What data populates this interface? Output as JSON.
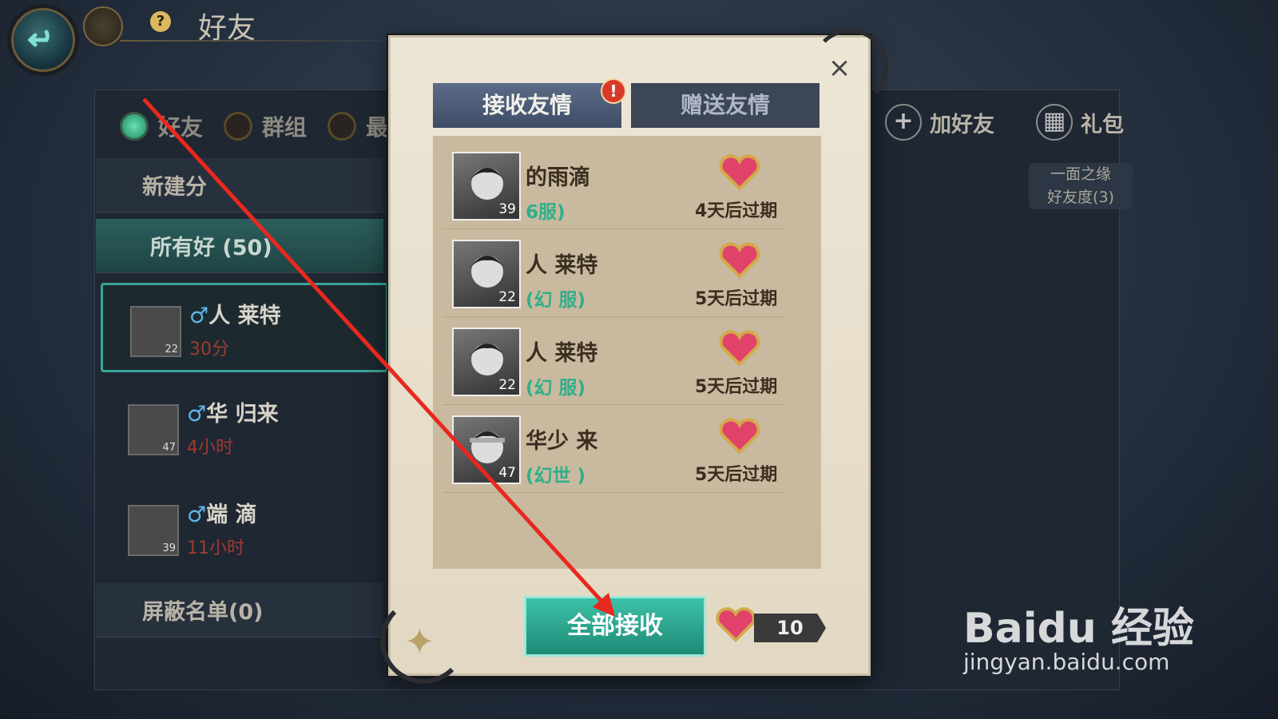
{
  "header": {
    "title": "好友",
    "help": "?"
  },
  "tabs": [
    "好友",
    "群组",
    "最近"
  ],
  "sidebar": {
    "new_group": "新建分",
    "all_friends": "所有好      (50)",
    "blocklist": "屏蔽名单(0)"
  },
  "friends": [
    {
      "name": "人        莱特",
      "time": "30分",
      "level": "22"
    },
    {
      "name": "华        归来",
      "time": "4小时",
      "level": "47"
    },
    {
      "name": "端        滴",
      "time": "11小时",
      "level": "39"
    }
  ],
  "right_actions": {
    "add_friend": "加好友",
    "gift": "礼包"
  },
  "bond": {
    "line1": "一面之缘",
    "line2": "好友度(3)"
  },
  "modal": {
    "tab_receive": "接收友情",
    "tab_send": "赠送友情",
    "badge": "!",
    "close": "×",
    "rows": [
      {
        "name": "       的雨滴",
        "server": "       6服)",
        "expiry": "4天后过期",
        "level": "39"
      },
      {
        "name": "人       莱特",
        "server": "(幻        服)",
        "expiry": "5天后过期",
        "level": "22"
      },
      {
        "name": "人       莱特",
        "server": "(幻        服)",
        "expiry": "5天后过期",
        "level": "22"
      },
      {
        "name": "华少       来",
        "server": "(幻世       )",
        "expiry": "5天后过期",
        "level": "47"
      }
    ],
    "accept_all": "全部接收",
    "count": "10"
  },
  "watermark": {
    "logo": "Baidu 经验",
    "url": "jingyan.baidu.com"
  },
  "colors": {
    "accent": "#2fb08a",
    "badge": "#d83a2a",
    "arrow": "#e8281e"
  }
}
